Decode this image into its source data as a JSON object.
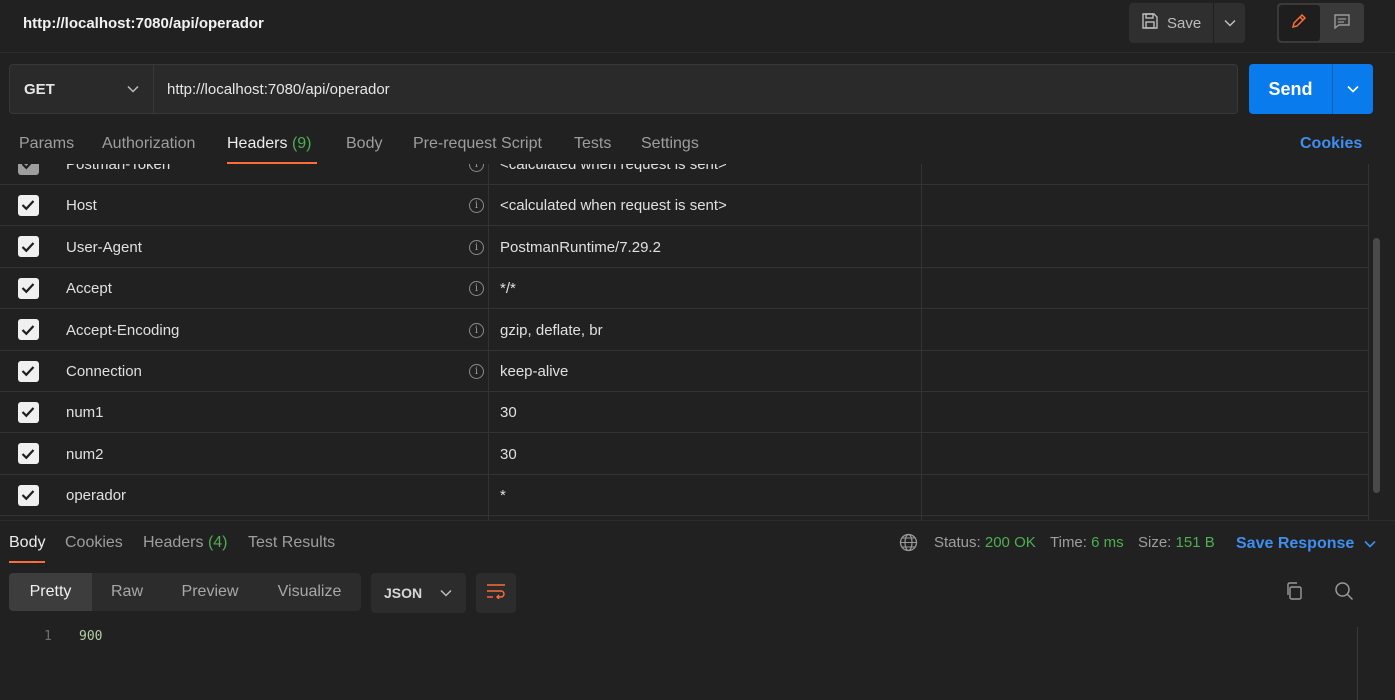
{
  "header": {
    "title": "http://localhost:7080/api/operador",
    "save_label": "Save"
  },
  "request": {
    "method": "GET",
    "url": "http://localhost:7080/api/operador",
    "send_label": "Send"
  },
  "request_tabs": {
    "params": "Params",
    "authorization": "Authorization",
    "headers": "Headers",
    "headers_count": "(9)",
    "body": "Body",
    "prerequest": "Pre-request Script",
    "tests": "Tests",
    "settings": "Settings",
    "cookies": "Cookies"
  },
  "headers_table": {
    "rows": [
      {
        "key": "Postman-Token",
        "value": "<calculated when request is sent>",
        "checked": true,
        "auto": true
      },
      {
        "key": "Host",
        "value": "<calculated when request is sent>",
        "checked": true,
        "auto": true
      },
      {
        "key": "User-Agent",
        "value": "PostmanRuntime/7.29.2",
        "checked": true,
        "auto": true
      },
      {
        "key": "Accept",
        "value": "*/*",
        "checked": true,
        "auto": true
      },
      {
        "key": "Accept-Encoding",
        "value": "gzip, deflate, br",
        "checked": true,
        "auto": true
      },
      {
        "key": "Connection",
        "value": "keep-alive",
        "checked": true,
        "auto": true
      },
      {
        "key": "num1",
        "value": "30",
        "checked": true,
        "auto": false
      },
      {
        "key": "num2",
        "value": "30",
        "checked": true,
        "auto": false
      },
      {
        "key": "operador",
        "value": "*",
        "checked": true,
        "auto": false
      }
    ]
  },
  "response_tabs": {
    "body": "Body",
    "cookies": "Cookies",
    "headers": "Headers",
    "headers_count": "(4)",
    "test_results": "Test Results"
  },
  "response_status": {
    "status_label": "Status:",
    "status_value": "200 OK",
    "time_label": "Time:",
    "time_value": "6 ms",
    "size_label": "Size:",
    "size_value": "151 B",
    "save_response": "Save Response"
  },
  "response_view": {
    "modes": [
      "Pretty",
      "Raw",
      "Preview",
      "Visualize"
    ],
    "format": "JSON"
  },
  "response_body": {
    "line_number": "1",
    "content": "900"
  },
  "colors": {
    "accent_orange": "#ff6c37",
    "send_blue": "#097bed",
    "link_blue": "#3d8ff0",
    "success_green": "#4caf50"
  }
}
